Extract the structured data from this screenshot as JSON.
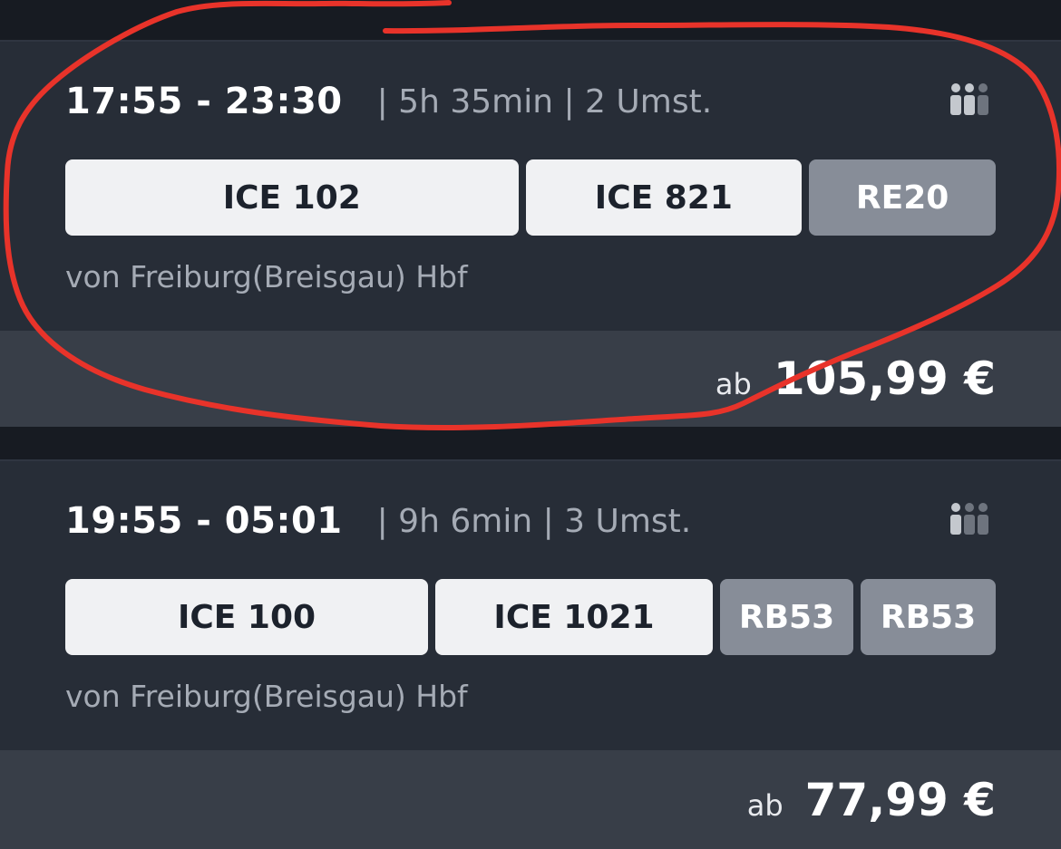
{
  "connections": [
    {
      "times": "17:55 - 23:30",
      "meta": "| 5h 35min | 2 Umst.",
      "trains": [
        {
          "label": "ICE 102",
          "style": "light"
        },
        {
          "label": "ICE 821",
          "style": "light"
        },
        {
          "label": "RE20",
          "style": "grey"
        }
      ],
      "origin": "von Freiburg(Breisgau) Hbf",
      "price_prefix": "ab",
      "price": "105,99 €"
    },
    {
      "times": "19:55 - 05:01",
      "meta": "| 9h 6min | 3 Umst.",
      "trains": [
        {
          "label": "ICE 100",
          "style": "light"
        },
        {
          "label": "ICE 1021",
          "style": "light"
        },
        {
          "label": "RB53",
          "style": "grey"
        },
        {
          "label": "RB53",
          "style": "grey"
        }
      ],
      "origin": "von Freiburg(Breisgau) Hbf",
      "price_prefix": "ab",
      "price": "77,99 €"
    }
  ],
  "icons": {
    "occupancy": "occupancy-icon"
  },
  "colors": {
    "background": "#171b22",
    "card": "#272d37",
    "price_bar": "#383e48",
    "train_light": "#f0f1f3",
    "train_grey": "#878d98",
    "annotation_stroke": "#e8332a"
  }
}
